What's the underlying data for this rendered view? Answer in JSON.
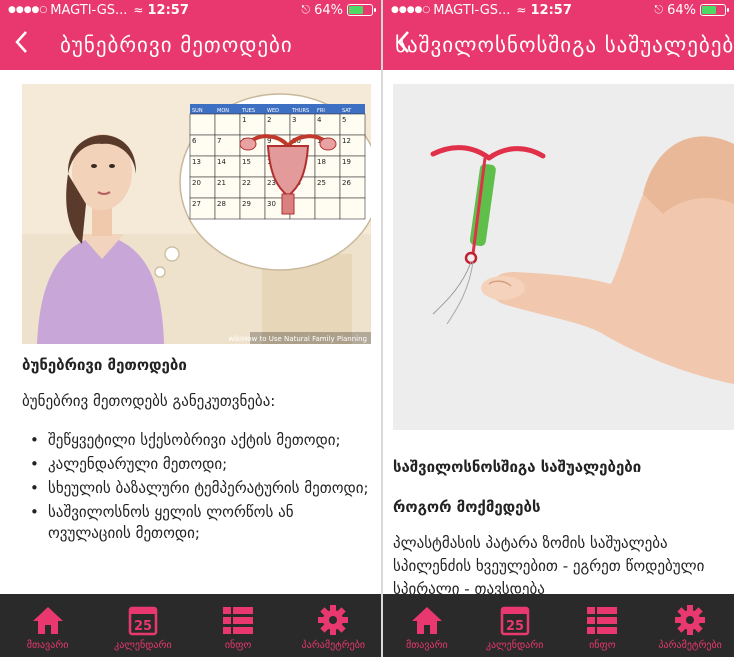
{
  "status_bar": {
    "carrier": "MAGTI-GS...",
    "time": "12:57",
    "battery": "64%",
    "battery_level": 0.64
  },
  "colors": {
    "accent": "#e8386f",
    "tab_bg": "#2a2a2a"
  },
  "left_screen": {
    "title": "ბუნებრივი მეთოდები",
    "back_icon": "chevron-left-icon",
    "calendar": {
      "days": [
        "SUN",
        "MON",
        "TUES",
        "WED",
        "THURS",
        "FRI",
        "SAT"
      ],
      "rows": [
        [
          "",
          "",
          "1",
          "2",
          "3",
          "4",
          "5"
        ],
        [
          "6",
          "7",
          "8",
          "9",
          "10",
          "11",
          "12"
        ],
        [
          "13",
          "14",
          "15",
          "16",
          "17",
          "18",
          "19"
        ],
        [
          "20",
          "21",
          "22",
          "23",
          "24",
          "25",
          "26"
        ],
        [
          "27",
          "28",
          "29",
          "30",
          "",
          "",
          ""
        ]
      ]
    },
    "image_caption": "wikiHow to Use Natural Family Planning",
    "section_title": "ბუნებრივი მეთოდები",
    "intro": "ბუნებრივ მეთოდებს განეკუთვნება:",
    "methods": [
      "შეწყვეტილი სქესობრივი აქტის მეთოდი;",
      "კალენდარული მეთოდი;",
      "სხეულის ბაზალური ტემპერატურის მეთოდი;",
      "საშვილოსნოს ყელის ლორწოს ან ოვულაციის მეთოდი;"
    ]
  },
  "right_screen": {
    "title": "საშვილოსნოსშიგა საშუალებები",
    "back_icon": "chevron-left-icon",
    "section_title": "საშვილოსნოსშიგა საშუალებები",
    "subtitle": "როგორ მოქმედებს",
    "body": "პლასტმასის პატარა ზომის საშუალება სპილენძის ხვეულებით - ეგრეთ წოდებული სპირალი - თავსდება"
  },
  "tab_bar": {
    "tabs": [
      {
        "label": "მთავარი",
        "icon": "home-icon"
      },
      {
        "label": "კალენდარი",
        "icon": "calendar-icon",
        "icon_text": "25"
      },
      {
        "label": "ინფო",
        "icon": "list-icon"
      },
      {
        "label": "პარამეტრები",
        "icon": "gear-icon"
      }
    ],
    "active_index": 2
  }
}
